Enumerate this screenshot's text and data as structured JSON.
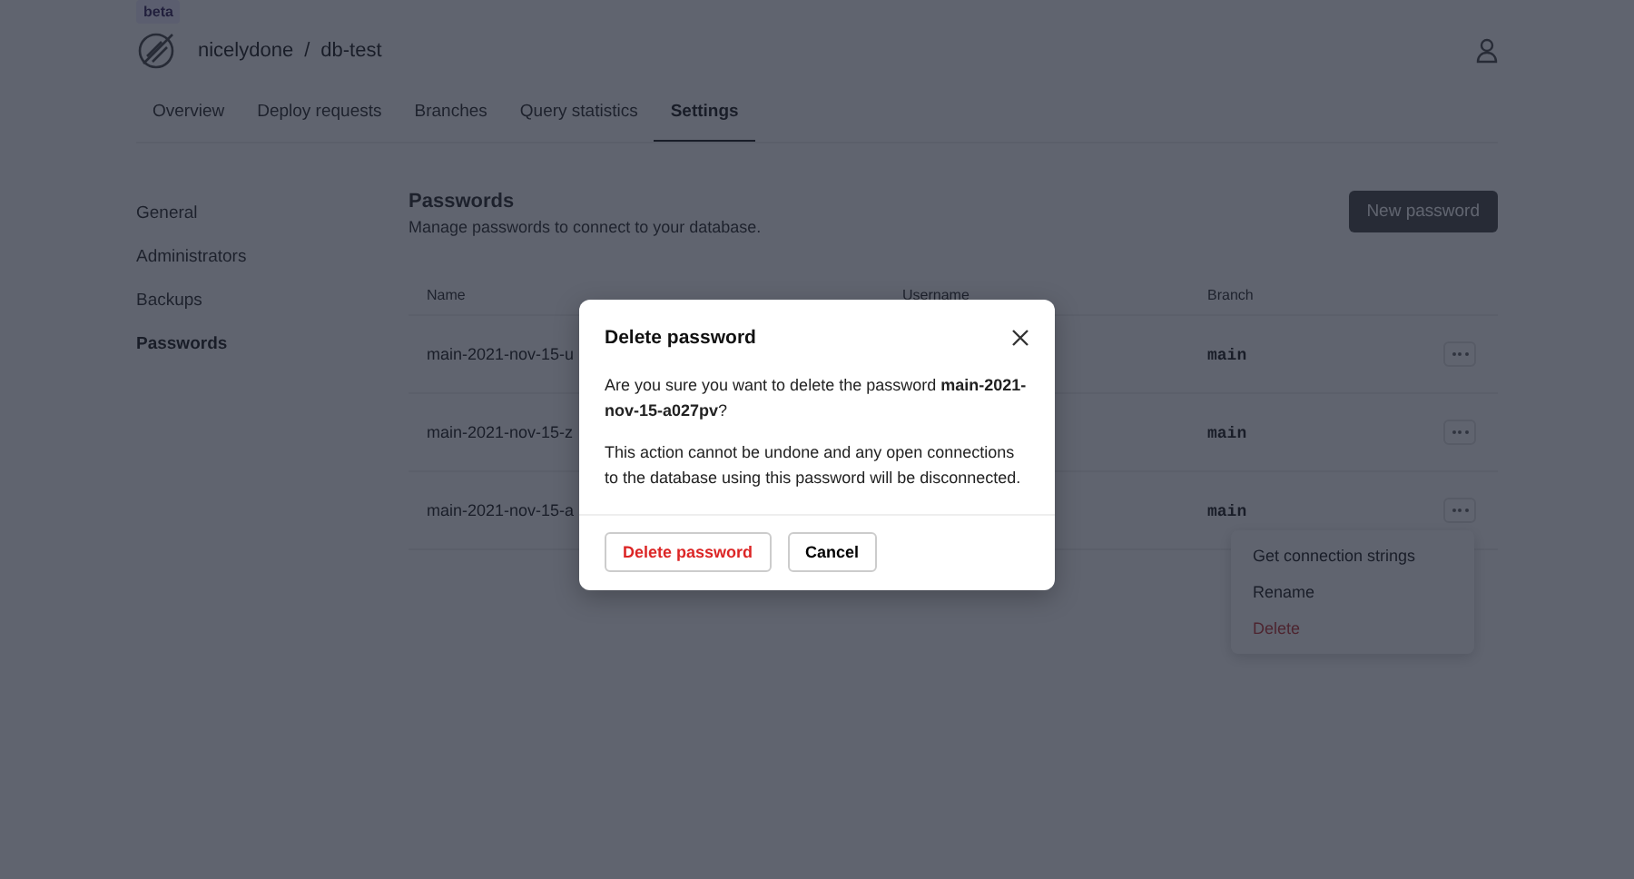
{
  "header": {
    "badge": "beta",
    "org": "nicelydone",
    "separator": "/",
    "database": "db-test"
  },
  "tabs": [
    {
      "label": "Overview",
      "selected": false
    },
    {
      "label": "Deploy requests",
      "selected": false
    },
    {
      "label": "Branches",
      "selected": false
    },
    {
      "label": "Query statistics",
      "selected": false
    },
    {
      "label": "Settings",
      "selected": true
    }
  ],
  "sidebar": {
    "items": [
      {
        "label": "General",
        "selected": false
      },
      {
        "label": "Administrators",
        "selected": false
      },
      {
        "label": "Backups",
        "selected": false
      },
      {
        "label": "Passwords",
        "selected": true
      }
    ]
  },
  "section": {
    "title": "Passwords",
    "subtitle": "Manage passwords to connect to your database.",
    "new_button": "New password"
  },
  "table": {
    "columns": [
      "Name",
      "Username",
      "Branch"
    ],
    "rows": [
      {
        "name": "main-2021-nov-15-u",
        "branch": "main"
      },
      {
        "name": "main-2021-nov-15-z",
        "branch": "main"
      },
      {
        "name": "main-2021-nov-15-a",
        "branch": "main"
      }
    ]
  },
  "row_menu": {
    "items": [
      {
        "label": "Get connection strings",
        "kind": "normal"
      },
      {
        "label": "Rename",
        "kind": "normal"
      },
      {
        "label": "Delete",
        "kind": "danger"
      }
    ]
  },
  "dialog": {
    "title": "Delete password",
    "message": "Are you sure you want to delete the password **main-2021-nov-15-a027pv**?",
    "warning": "This action cannot be undone and any open connections to the database using this password will be disconnected.",
    "confirm_button": "Delete password",
    "cancel_button": "Cancel"
  }
}
